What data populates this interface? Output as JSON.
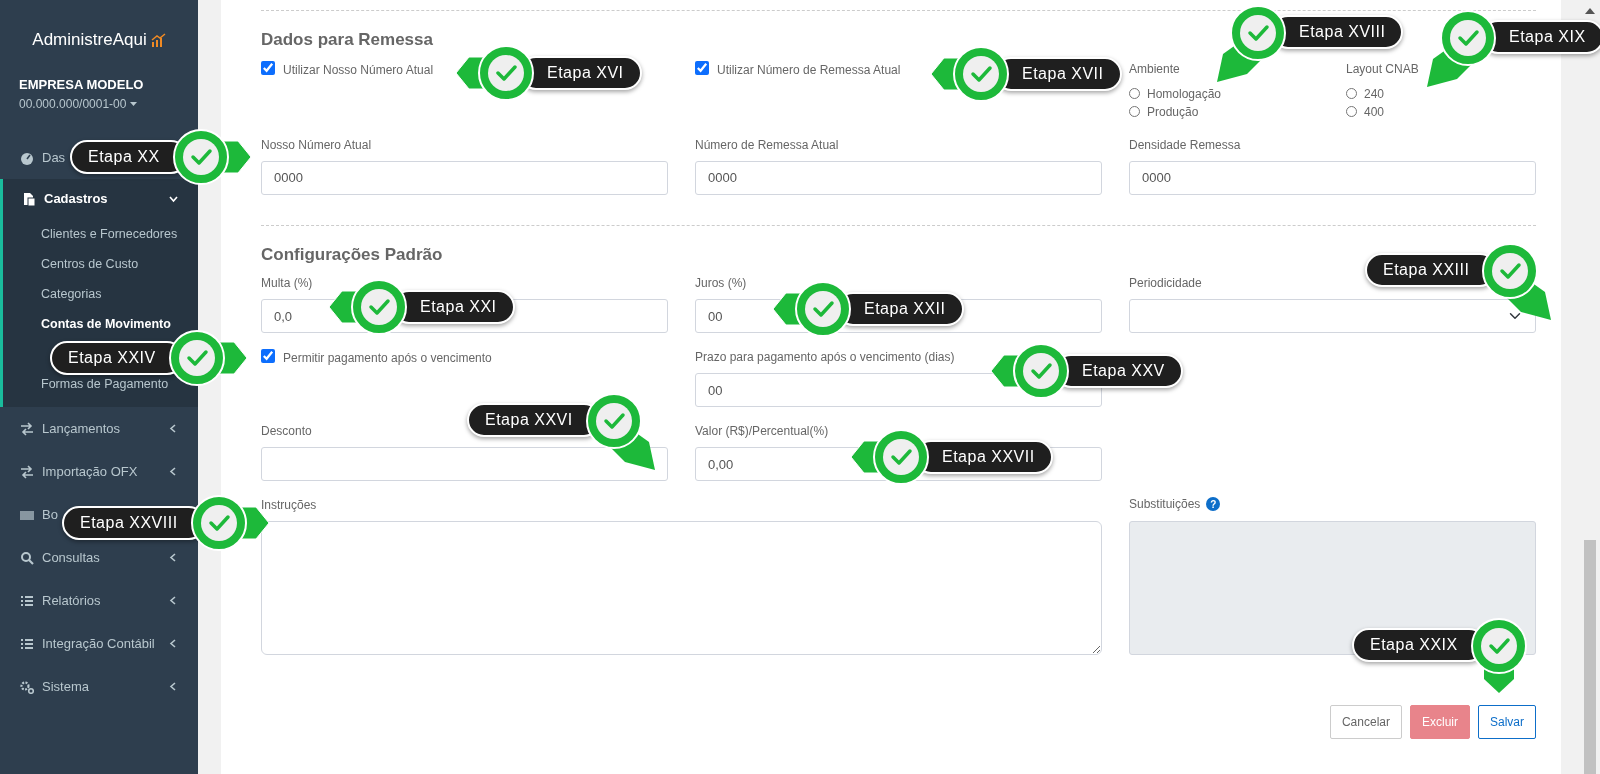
{
  "sidebar": {
    "brand": "AdministreAqui",
    "company": "EMPRESA MODELO",
    "company_id": "00.000.000/0001-00",
    "menu": [
      {
        "label": "Das"
      },
      {
        "label": "Cadastros",
        "expanded": true,
        "children": [
          {
            "label": "Clientes e Fornecedores",
            "selected": false
          },
          {
            "label": "Centros de Custo",
            "selected": false
          },
          {
            "label": "Categorias",
            "selected": false
          },
          {
            "label": "Contas de Movimento",
            "selected": true
          },
          {
            "label": "Formas de Pagamento",
            "selected": false
          }
        ]
      },
      {
        "label": "Lançamentos",
        "expanded": false
      },
      {
        "label": "Importação OFX",
        "expanded": false
      },
      {
        "label": "Bo"
      },
      {
        "label": "Consultas",
        "expanded": false
      },
      {
        "label": "Relatórios",
        "expanded": false
      },
      {
        "label": "Integração Contábil",
        "expanded": false
      },
      {
        "label": "Sistema",
        "expanded": false
      }
    ]
  },
  "sections": [
    {
      "title": "Dados para Remessa",
      "rows": [
        [
          {
            "kind": "checkbox",
            "label": "Utilizar Nosso Número Atual",
            "checked": true
          },
          {
            "kind": "checkbox",
            "label": "Utilizar Número de Remessa Atual",
            "checked": true
          },
          {
            "kind": "radio-group",
            "label": "Ambiente",
            "options": [
              {
                "label": "Homologação",
                "selected": false
              },
              {
                "label": "Produção",
                "selected": false
              }
            ]
          },
          {
            "kind": "radio-group",
            "label": "Layout CNAB",
            "options": [
              {
                "label": "240",
                "selected": false
              },
              {
                "label": "400",
                "selected": false
              }
            ]
          }
        ],
        [
          {
            "kind": "input",
            "label": "Nosso Número Atual",
            "value": "0000"
          },
          {
            "kind": "input",
            "label": "Número de Remessa Atual",
            "value": "0000"
          },
          {
            "kind": "input",
            "label": "Densidade Remessa",
            "value": "0000"
          }
        ]
      ]
    },
    {
      "title": "Configurações Padrão",
      "rows": [
        [
          {
            "kind": "input",
            "label": "Multa (%)",
            "value": "0,0"
          },
          {
            "kind": "input",
            "label": "Juros (%)",
            "value": "00"
          },
          {
            "kind": "select",
            "label": "Periodicidade"
          }
        ],
        [
          {
            "kind": "checkbox",
            "label": "Permitir pagamento após o vencimento",
            "checked": true
          },
          {
            "kind": "input",
            "label": "Prazo para pagamento após o vencimento (dias)",
            "value": "00"
          }
        ],
        [
          {
            "kind": "select",
            "label": "Desconto"
          },
          {
            "kind": "input",
            "label": "Valor (R$)/Percentual(%)",
            "value": "0,00"
          }
        ],
        [
          {
            "kind": "textarea",
            "label": "Instruções"
          },
          "",
          {
            "kind": "readonly-textarea",
            "label": "Substituições",
            "help": "?"
          }
        ]
      ]
    }
  ],
  "buttons": [
    {
      "label": "Cancelar",
      "kind": "secondary",
      "disabled": false
    },
    {
      "label": "Excluir",
      "kind": "danger",
      "disabled": true
    },
    {
      "label": "Salvar",
      "kind": "primary",
      "disabled": false
    }
  ],
  "callouts": [
    {
      "label": "Etapa XVI",
      "kind": "left"
    },
    {
      "label": "Etapa XVII",
      "kind": "left"
    },
    {
      "label": "Etapa XVIII",
      "kind": "down-left"
    },
    {
      "label": "Etapa XIX",
      "kind": "down-left"
    },
    {
      "label": "Etapa XX",
      "kind": "right"
    },
    {
      "label": "Etapa XXI",
      "kind": "left"
    },
    {
      "label": "Etapa XXII",
      "kind": "left"
    },
    {
      "label": "Etapa XXIII",
      "kind": "down-right"
    },
    {
      "label": "Etapa XXIV",
      "kind": "right"
    },
    {
      "label": "Etapa XXV",
      "kind": "left"
    },
    {
      "label": "Etapa XXVI",
      "kind": "down-right"
    },
    {
      "label": "Etapa XXVII",
      "kind": "left"
    },
    {
      "label": "Etapa XXVIII",
      "kind": "right"
    },
    {
      "label": "Etapa XXIX",
      "kind": "down"
    }
  ]
}
